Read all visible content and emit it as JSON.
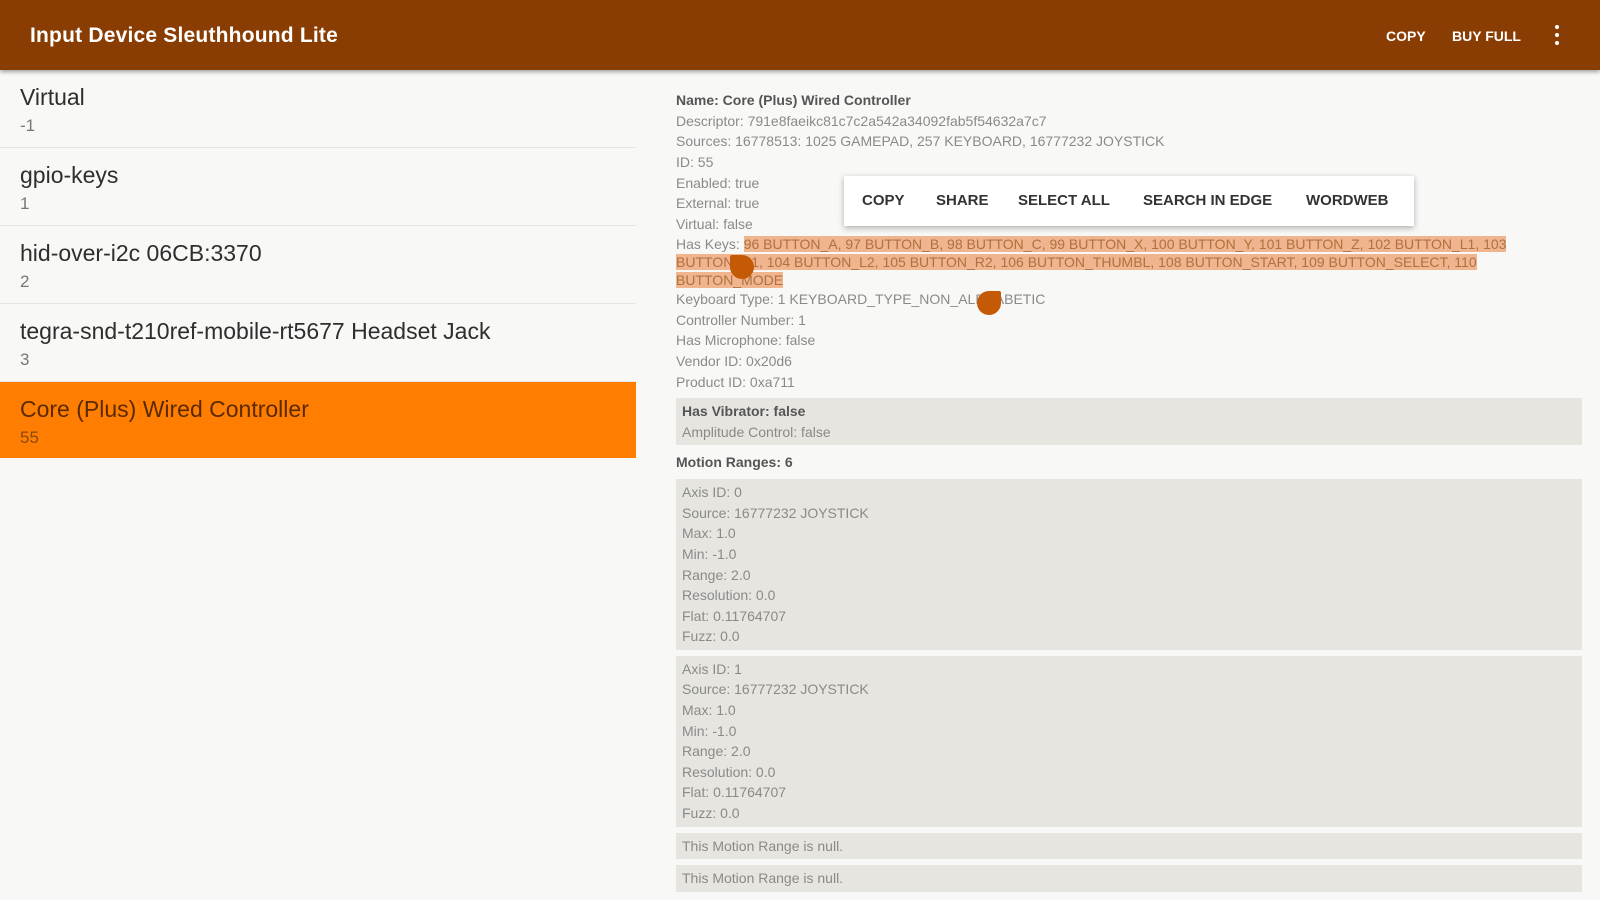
{
  "appbar": {
    "title": "Input Device Sleuthhound Lite",
    "copy_label": "COPY",
    "buy_label": "BUY FULL",
    "overflow_icon": "more-vert-icon",
    "color": "#8a3d03"
  },
  "devices": [
    {
      "name": "Virtual",
      "id": "-1"
    },
    {
      "name": "gpio-keys",
      "id": "1"
    },
    {
      "name": "hid-over-i2c 06CB:3370",
      "id": "2"
    },
    {
      "name": "tegra-snd-t210ref-mobile-rt5677 Headset Jack",
      "id": "3"
    },
    {
      "name": "Core (Plus) Wired Controller",
      "id": "55"
    }
  ],
  "selected_color": "#ff7d00",
  "details": {
    "name": "Name: Core (Plus) Wired Controller",
    "descriptor": "Descriptor: 791e8faeikc81c7c2a542a34092fab5f54632a7c7",
    "sources": "Sources: 16778513: 1025 GAMEPAD, 257 KEYBOARD, 16777232 JOYSTICK",
    "id": "ID: 55",
    "enabled": "Enabled: true",
    "external": "External: true",
    "virtual": "Virtual: false",
    "has_keys_label": "Has Keys: ",
    "has_keys_value": "96 BUTTON_A, 97 BUTTON_B, 98 BUTTON_C, 99 BUTTON_X, 100 BUTTON_Y, 101 BUTTON_Z, 102 BUTTON_L1, 103 BUTTON_R1, 104 BUTTON_L2, 105 BUTTON_R2, 106 BUTTON_THUMBL, 108 BUTTON_START, 109 BUTTON_SELECT, 110 BUTTON_MODE",
    "keyboard_type": "Keyboard Type: 1 KEYBOARD_TYPE_NON_ALPHABETIC",
    "controller_number": "Controller Number: 1",
    "has_microphone": "Has Microphone: false",
    "vendor_id": "Vendor ID: 0x20d6",
    "product_id": "Product ID: 0xa711",
    "vibrator": {
      "has_vibrator": "Has Vibrator: false",
      "amplitude": "Amplitude Control: false"
    },
    "motion_ranges_header": "Motion Ranges: 6",
    "ranges": [
      {
        "axis": "Axis ID: 0",
        "source": "Source: 16777232 JOYSTICK",
        "max": "Max: 1.0",
        "min": "Min: -1.0",
        "range": "Range: 2.0",
        "resolution": "Resolution: 0.0",
        "flat": "Flat: 0.11764707",
        "fuzz": "Fuzz: 0.0"
      },
      {
        "axis": "Axis ID: 1",
        "source": "Source: 16777232 JOYSTICK",
        "max": "Max: 1.0",
        "min": "Min: -1.0",
        "range": "Range: 2.0",
        "resolution": "Resolution: 0.0",
        "flat": "Flat: 0.11764707",
        "fuzz": "Fuzz: 0.0"
      }
    ],
    "null_range": "This Motion Range is null.",
    "null_range_2": "This Motion Range is null."
  },
  "selection_popup": {
    "copy": "COPY",
    "share": "SHARE",
    "select_all": "SELECT ALL",
    "search": "SEARCH IN EDGE",
    "wordweb": "WORDWEB"
  }
}
